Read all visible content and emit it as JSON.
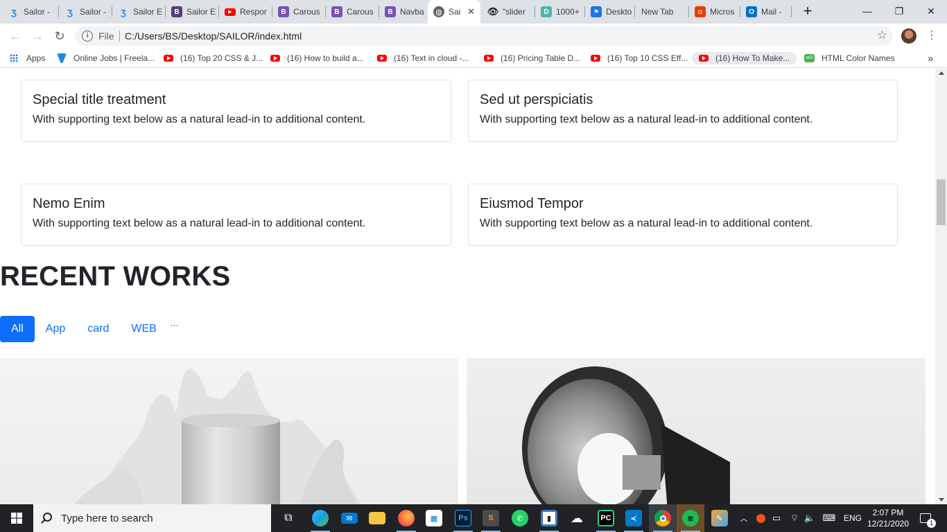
{
  "browser": {
    "tabs": [
      {
        "title": "Sailor -",
        "favicon": "sailor-icon",
        "color": "#2d8cf0"
      },
      {
        "title": "Sailor -",
        "favicon": "sailor-icon",
        "color": "#2d8cf0"
      },
      {
        "title": "Sailor E",
        "favicon": "sailor-icon",
        "color": "#2d8cf0"
      },
      {
        "title": "Sailor E",
        "favicon": "bootstrap-icon",
        "color": "#563d7c"
      },
      {
        "title": "Respor",
        "favicon": "youtube-icon",
        "color": "#ff0000"
      },
      {
        "title": "Carous",
        "favicon": "bootstrap-icon",
        "color": "#7952b3"
      },
      {
        "title": "Carous",
        "favicon": "bootstrap-icon",
        "color": "#7952b3"
      },
      {
        "title": "Navba",
        "favicon": "bootstrap-icon",
        "color": "#7952b3"
      },
      {
        "title": "Sai",
        "favicon": "globe-icon",
        "color": "#5f6368",
        "active": true
      },
      {
        "title": "\"slider",
        "favicon": "eye-icon",
        "color": "#202124"
      },
      {
        "title": "1000+",
        "favicon": "d-icon",
        "color": "#4db6ac"
      },
      {
        "title": "Deskto",
        "favicon": "flag-icon",
        "color": "#1a73e8"
      },
      {
        "title": "New Tab",
        "favicon": "",
        "color": ""
      },
      {
        "title": "Micros",
        "favicon": "office-icon",
        "color": "#eb3c00"
      },
      {
        "title": "Mail -",
        "favicon": "outlook-icon",
        "color": "#0072c6"
      }
    ],
    "new_tab_label": "+",
    "window": {
      "minimize": "—",
      "restore": "❐",
      "close": "✕"
    },
    "address": {
      "scheme_label": "File",
      "url": "C:/Users/BS/Desktop/SAILOR/index.html"
    },
    "bookmarks": [
      {
        "label": "Apps",
        "icon": "apps-grid-icon"
      },
      {
        "label": "Online Jobs | Freela...",
        "icon": "upwork-icon"
      },
      {
        "label": "(16) Top 20 CSS & J...",
        "icon": "youtube-icon"
      },
      {
        "label": "(16) How to build a...",
        "icon": "youtube-icon"
      },
      {
        "label": "(16) Text in cloud -...",
        "icon": "youtube-icon"
      },
      {
        "label": "(16) Pricing Table D...",
        "icon": "youtube-icon"
      },
      {
        "label": "(16) Top 10 CSS Eff...",
        "icon": "youtube-icon"
      },
      {
        "label": "(16) How To Make...",
        "icon": "youtube-icon"
      },
      {
        "label": "HTML Color Names",
        "icon": "w3-icon"
      }
    ],
    "bookmarks_more": "»"
  },
  "page": {
    "cards": [
      {
        "title": "Special title treatment",
        "text": "With supporting text below as a natural lead-in to additional content."
      },
      {
        "title": "Sed ut perspiciatis",
        "text": "With supporting text below as a natural lead-in to additional content."
      },
      {
        "title": "Nemo Enim",
        "text": "With supporting text below as a natural lead-in to additional content."
      },
      {
        "title": "Eiusmod Tempor",
        "text": "With supporting text below as a natural lead-in to additional content."
      }
    ],
    "section_title": "RECENT WORKS",
    "filters": [
      {
        "label": "All",
        "active": true
      },
      {
        "label": "App",
        "active": false
      },
      {
        "label": "card",
        "active": false
      },
      {
        "label": "WEB",
        "active": false
      }
    ],
    "filters_more": "···",
    "accent_color": "#0d6efd"
  },
  "taskbar": {
    "search_placeholder": "Type here to search",
    "apps": [
      "task-view-icon",
      "edge-icon",
      "mail-icon",
      "file-explorer-icon",
      "firefox-icon",
      "store-icon",
      "photoshop-icon",
      "sublime-icon",
      "whatsapp-icon",
      "bracket-app-icon",
      "soundcloud-icon",
      "pycharm-icon",
      "vscode-icon",
      "chrome-icon",
      "spotify-icon",
      "paint-icon"
    ],
    "tray": {
      "language": "ENG",
      "time": "2:07 PM",
      "date": "12/21/2020",
      "notifications": "1"
    }
  }
}
